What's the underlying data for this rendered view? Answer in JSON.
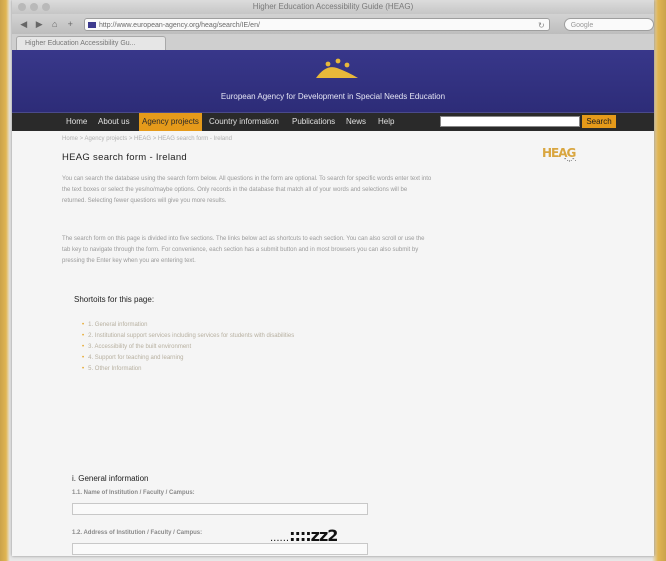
{
  "browser": {
    "window_title": "Higher Education Accessibility Guide (HEAG)",
    "url": "http://www.european-agency.org/heag/search/IE/en/",
    "search_placeholder": "Google",
    "tab_title": "Higher Education Accessibility Gu..."
  },
  "site": {
    "org_name": "European Agency for Development in Special Needs Education",
    "nav": [
      "Home",
      "About us",
      "Agency projects",
      "Country information",
      "Publications",
      "News",
      "Help"
    ],
    "active_nav": "Agency projects",
    "search_button": "Search"
  },
  "content": {
    "breadcrumb": "Home > Agency projects > HEAG > HEAG search form - Ireland",
    "title": "HEAG search form - Ireland",
    "heag_logo": "HEAG",
    "heag_dots": "-.,.-.",
    "intro": "You can search the database using the search form below. All questions in the form are optional. To search for specific words enter text into the text boxes or select the yes/no/maybe options. Only records in the database that match all of your words and selections will be returned. Selecting fewer questions will give you more results.",
    "sections_text": "The search form on this page is divided into five sections. The links below act as shortcuts to each section. You can also scroll or use the tab key to navigate through the form. For convenience, each section has a submit button and in most browsers you can also submit by pressing the Enter key when you are entering text.",
    "shortcuts_heading": "Shortoits for this page:",
    "shortcuts": [
      "1. General information",
      "2. Institutional support services including services for students with disabilities",
      "3. Accessibility of the built environment",
      "4. Support for teaching and learning",
      "5. Other Information"
    ],
    "section_heading": "i.  General information",
    "field1_label": "1.1. Name of Institution / Faculty / Campus:",
    "field2_label": "1.2. Address of Institution / Faculty / Campus:",
    "artifact_dots": "......",
    "artifact_text": "::::zz2"
  },
  "colors": {
    "banner": "#2d2c78",
    "nav_bg": "#2a2a2a",
    "accent": "#e59a1a"
  }
}
